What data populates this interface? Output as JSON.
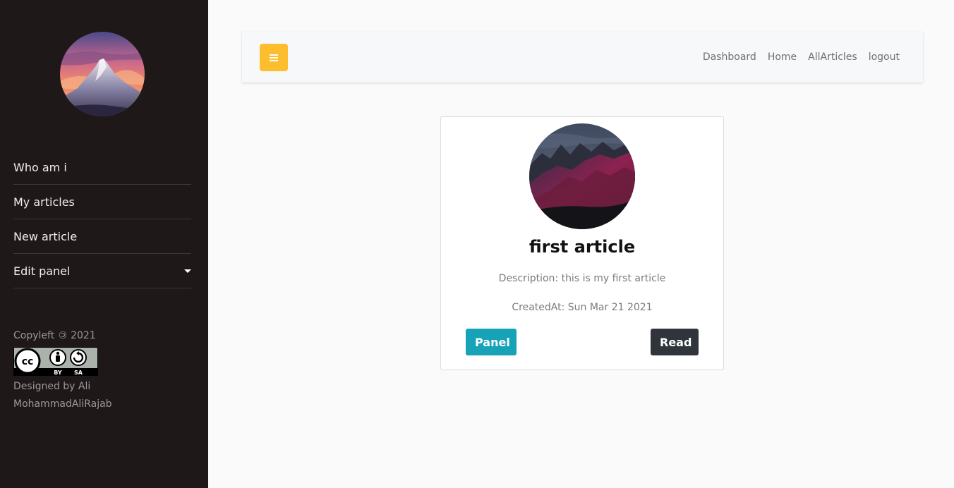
{
  "sidebar": {
    "nav": [
      {
        "label": "Who am i"
      },
      {
        "label": "My articles"
      },
      {
        "label": "New article"
      },
      {
        "label": "Edit panel",
        "has_dropdown": true
      }
    ],
    "footer": {
      "copyleft_prefix": "Copyleft",
      "copyleft_symbol": "©",
      "year": "2021",
      "license_badge": {
        "cc": "cc",
        "by": "BY",
        "sa": "SA"
      },
      "designed_by_line1": "Designed by Ali",
      "designed_by_line2": "MohammadAliRajab"
    }
  },
  "topbar": {
    "links": [
      "Dashboard",
      "Home",
      "AllArticles",
      "logout"
    ],
    "toggle_icon": "hamburger-icon",
    "toggle_color": "#fcbe2d"
  },
  "article": {
    "title": "first article",
    "description": "Description: this is my first article",
    "created_at": "CreatedAt: Sun Mar 21 2021",
    "panel_label": "Panel",
    "read_label": "Read"
  },
  "colors": {
    "sidebar_bg": "#1e1819",
    "panel_button": "#17a2b8",
    "read_button": "#2f353b",
    "page_bg": "#fafafa"
  }
}
